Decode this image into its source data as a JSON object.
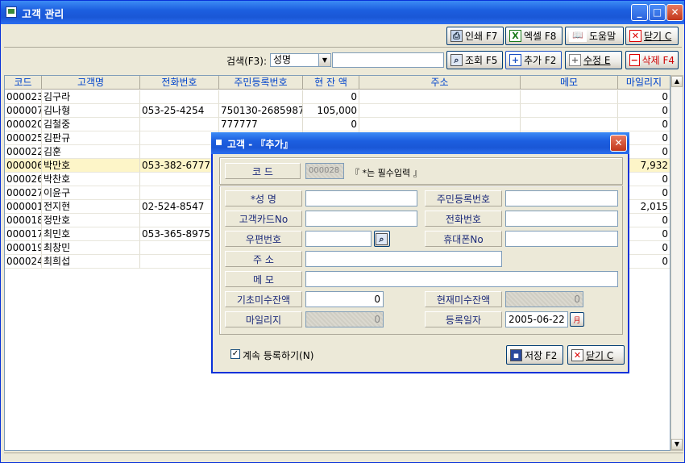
{
  "window": {
    "title": "고객 관리"
  },
  "toolbar": {
    "print": "인쇄 F7",
    "excel": "엑셀 F8",
    "help": "도움말",
    "close": "닫기 C",
    "search_label": "검색(F3):",
    "search_field": "성명",
    "search_value": "",
    "query": "조회 F5",
    "add": "추가 F2",
    "edit": "수정 E",
    "delete": "삭제 F4"
  },
  "grid": {
    "columns": [
      "코드",
      "고객명",
      "전화번호",
      "주민등록번호",
      "현 잔 액",
      "주소",
      "메모",
      "마일리지"
    ],
    "rows": [
      [
        "000023",
        "김구라",
        "",
        "",
        "0",
        "",
        "",
        "0"
      ],
      [
        "000007",
        "김나형",
        "053-25-4254",
        "750130-2685987",
        "105,000",
        "",
        "",
        "0"
      ],
      [
        "000020",
        "김철중",
        "",
        "777777",
        "0",
        "",
        "",
        "0"
      ],
      [
        "000025",
        "김판규",
        "",
        "",
        "",
        "",
        "",
        "0"
      ],
      [
        "000022",
        "김훈",
        "",
        "",
        "",
        "",
        "",
        "0"
      ],
      [
        "000006",
        "박만호",
        "053-382-6777",
        "",
        "",
        "",
        "",
        "7,932"
      ],
      [
        "000026",
        "박찬호",
        "",
        "",
        "",
        "",
        "",
        "0"
      ],
      [
        "000027",
        "이윤구",
        "",
        "",
        "",
        "",
        "",
        "0"
      ],
      [
        "000001",
        "전지현",
        "02-524-8547",
        "",
        "",
        "",
        "",
        "2,015"
      ],
      [
        "000018",
        "정만호",
        "",
        "",
        "",
        "",
        "",
        "0"
      ],
      [
        "000017",
        "최민호",
        "053-365-8975",
        "",
        "",
        "",
        "",
        "0"
      ],
      [
        "000019",
        "최창민",
        "",
        "",
        "",
        "",
        "",
        "0"
      ],
      [
        "000024",
        "최희섭",
        "",
        "",
        "",
        "",
        "",
        "0"
      ]
    ],
    "selected_index": 5
  },
  "dialog": {
    "title": "고객 - 『추가』",
    "code_label": "코    드",
    "code_value": "000028",
    "required_note": "『 *는 필수입력 』",
    "name_label": "*성      명",
    "name_value": "",
    "ssn_label": "주민등록번호",
    "ssn_value": "",
    "card_label": "고객카드No",
    "card_value": "",
    "phone_label": "전화번호",
    "phone_value": "",
    "zip_label": "우편번호",
    "zip_value": "",
    "mobile_label": "휴대폰No",
    "mobile_value": "",
    "address_label": "주      소",
    "address_value": "",
    "memo_label": "메      모",
    "memo_value": "",
    "initial_balance_label": "기초미수잔액",
    "initial_balance_value": "0",
    "current_balance_label": "현재미수잔액",
    "current_balance_value": "0",
    "mileage_label": "마일리지",
    "mileage_value": "0",
    "reg_date_label": "등록일자",
    "reg_date_value": "2005-06-22",
    "continue_label": "계속 등록하기(N)",
    "continue_checked": true,
    "save": "저장 F2",
    "close": "닫기 C"
  }
}
